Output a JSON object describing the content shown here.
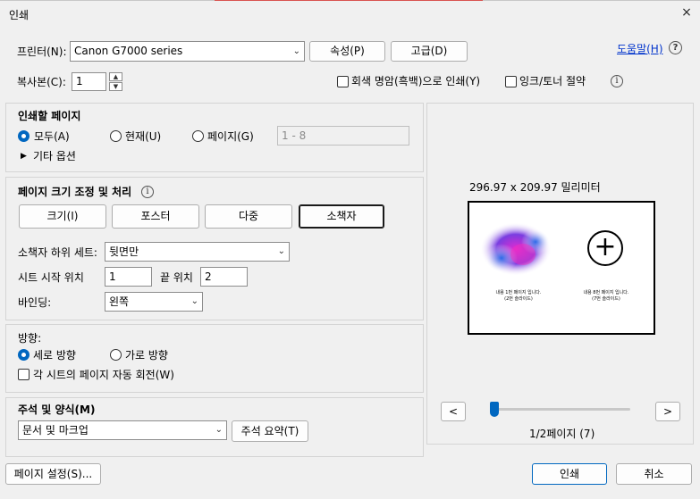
{
  "window": {
    "title": "인쇄",
    "close_icon": "×"
  },
  "printer": {
    "label": "프린터(N):",
    "selected": "Canon G7000 series",
    "properties_label": "속성(P)",
    "advanced_label": "고급(D)",
    "help_link": "도움말(H)",
    "help_icon": "?"
  },
  "copies": {
    "label": "복사본(C):",
    "value": "1",
    "grayscale_label": "회색 명암(흑백)으로 인쇄(Y)",
    "grayscale_checked": false,
    "ink_save_label": "잉크/토너 절약",
    "ink_save_checked": false
  },
  "pages_to_print": {
    "heading": "인쇄할 페이지",
    "all_label": "모두(A)",
    "current_label": "현재(U)",
    "pages_label": "페이지(G)",
    "pages_value": "1 - 8",
    "selected": "all",
    "more_options_label": "기타 옵션"
  },
  "page_sizing": {
    "heading": "페이지 크기 조정 및 처리",
    "size_label": "크기(I)",
    "poster_label": "포스터",
    "multiple_label": "다중",
    "booklet_label": "소책자",
    "selected": "booklet",
    "subset_label": "소책자 하위 세트:",
    "subset_value": "뒷면만",
    "sheets_from_label": "시트 시작 위치",
    "sheets_from_value": "1",
    "sheets_to_label": "끝 위치",
    "sheets_to_value": "2",
    "binding_label": "바인딩:",
    "binding_value": "왼쪽"
  },
  "orientation": {
    "heading": "방향:",
    "portrait_label": "세로 방향",
    "landscape_label": "가로 방향",
    "selected": "portrait",
    "auto_rotate_label": "각 시트의 페이지 자동 회전(W)",
    "auto_rotate_checked": false
  },
  "comments": {
    "heading": "주석 및 양식(M)",
    "value": "문서 및 마크업",
    "summary_label": "주석 요약(T)"
  },
  "preview": {
    "dimensions": "296.97 x 209.97 밀리미터",
    "left_page_line1": "내용 1번 페이지 입니다.",
    "left_page_line2": "(2번 슬라이드)",
    "right_page_line1": "내용 8번 페이지 입니다.",
    "right_page_line2": "(7번 슬라이드)",
    "plus_icon": "+",
    "prev_label": "<",
    "next_label": ">",
    "slider_fraction": 0,
    "page_status": "1/2페이지 (7)"
  },
  "footer": {
    "page_setup_label": "페이지 설정(S)...",
    "print_label": "인쇄",
    "cancel_label": "취소"
  },
  "colors": {
    "accent": "#0067c0",
    "link": "#0033cc"
  }
}
